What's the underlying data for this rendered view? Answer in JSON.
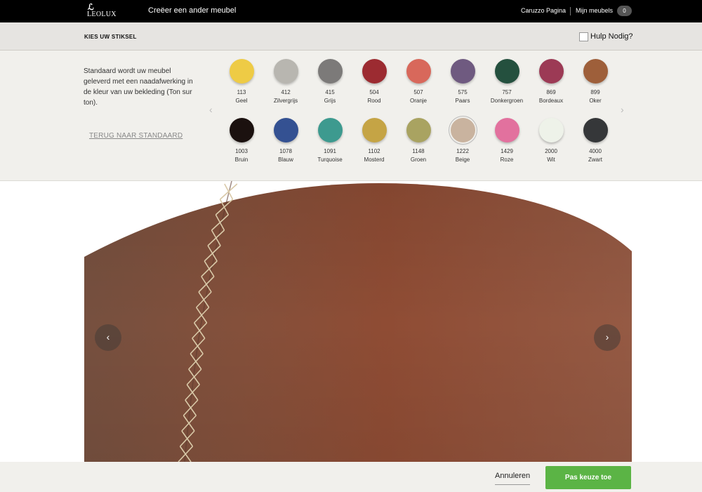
{
  "topbar": {
    "logo_mark": "ℒ",
    "logo_text": "LEOLUX",
    "create_label": "Creëer een ander meubel",
    "user_label": "Caruzzo Pagina",
    "favorites_label": "Mijn meubels",
    "favorites_count": "0"
  },
  "header": {
    "title": "KIES UW STIKSEL",
    "help_label": "Hulp Nodig?"
  },
  "panel": {
    "description": "Standaard wordt uw meubel geleverd met een naadafwerking in de kleur van uw bekleding (Ton sur ton).",
    "reset_label": "TERUG NAAR STANDAARD",
    "arrow_left": "‹",
    "arrow_right": "›",
    "swatches": [
      {
        "code": "113",
        "name": "Geel",
        "color": "#eecb45"
      },
      {
        "code": "412",
        "name": "Zilvergrijs",
        "color": "#b8b6b0"
      },
      {
        "code": "415",
        "name": "Grijs",
        "color": "#7c7a79"
      },
      {
        "code": "504",
        "name": "Rood",
        "color": "#9c2b31"
      },
      {
        "code": "507",
        "name": "Oranje",
        "color": "#d8685b"
      },
      {
        "code": "575",
        "name": "Paars",
        "color": "#6f5a80"
      },
      {
        "code": "757",
        "name": "Donkergroen",
        "color": "#24503e"
      },
      {
        "code": "869",
        "name": "Bordeaux",
        "color": "#9c3a55"
      },
      {
        "code": "899",
        "name": "Oker",
        "color": "#9e5f3a"
      },
      {
        "code": "1003",
        "name": "Bruin",
        "color": "#1b110f"
      },
      {
        "code": "1078",
        "name": "Blauw",
        "color": "#345192"
      },
      {
        "code": "1091",
        "name": "Turquoise",
        "color": "#3d9a8f"
      },
      {
        "code": "1102",
        "name": "Mosterd",
        "color": "#c5a445"
      },
      {
        "code": "1148",
        "name": "Groen",
        "color": "#a9a361"
      },
      {
        "code": "1222",
        "name": "Beige",
        "color": "#c9b39f"
      },
      {
        "code": "1429",
        "name": "Roze",
        "color": "#e2719e"
      },
      {
        "code": "2000",
        "name": "Wit",
        "color": "#eef2e9"
      },
      {
        "code": "4000",
        "name": "Zwart",
        "color": "#353739"
      }
    ],
    "selected_code": "1222"
  },
  "preview": {
    "prev_label": "‹",
    "next_label": "›",
    "leather_color": "#8d4c36",
    "stitch_color": "#d9c9a8"
  },
  "footer": {
    "cancel_label": "Annuleren",
    "apply_label": "Pas keuze toe",
    "apply_color": "#5bb445"
  }
}
